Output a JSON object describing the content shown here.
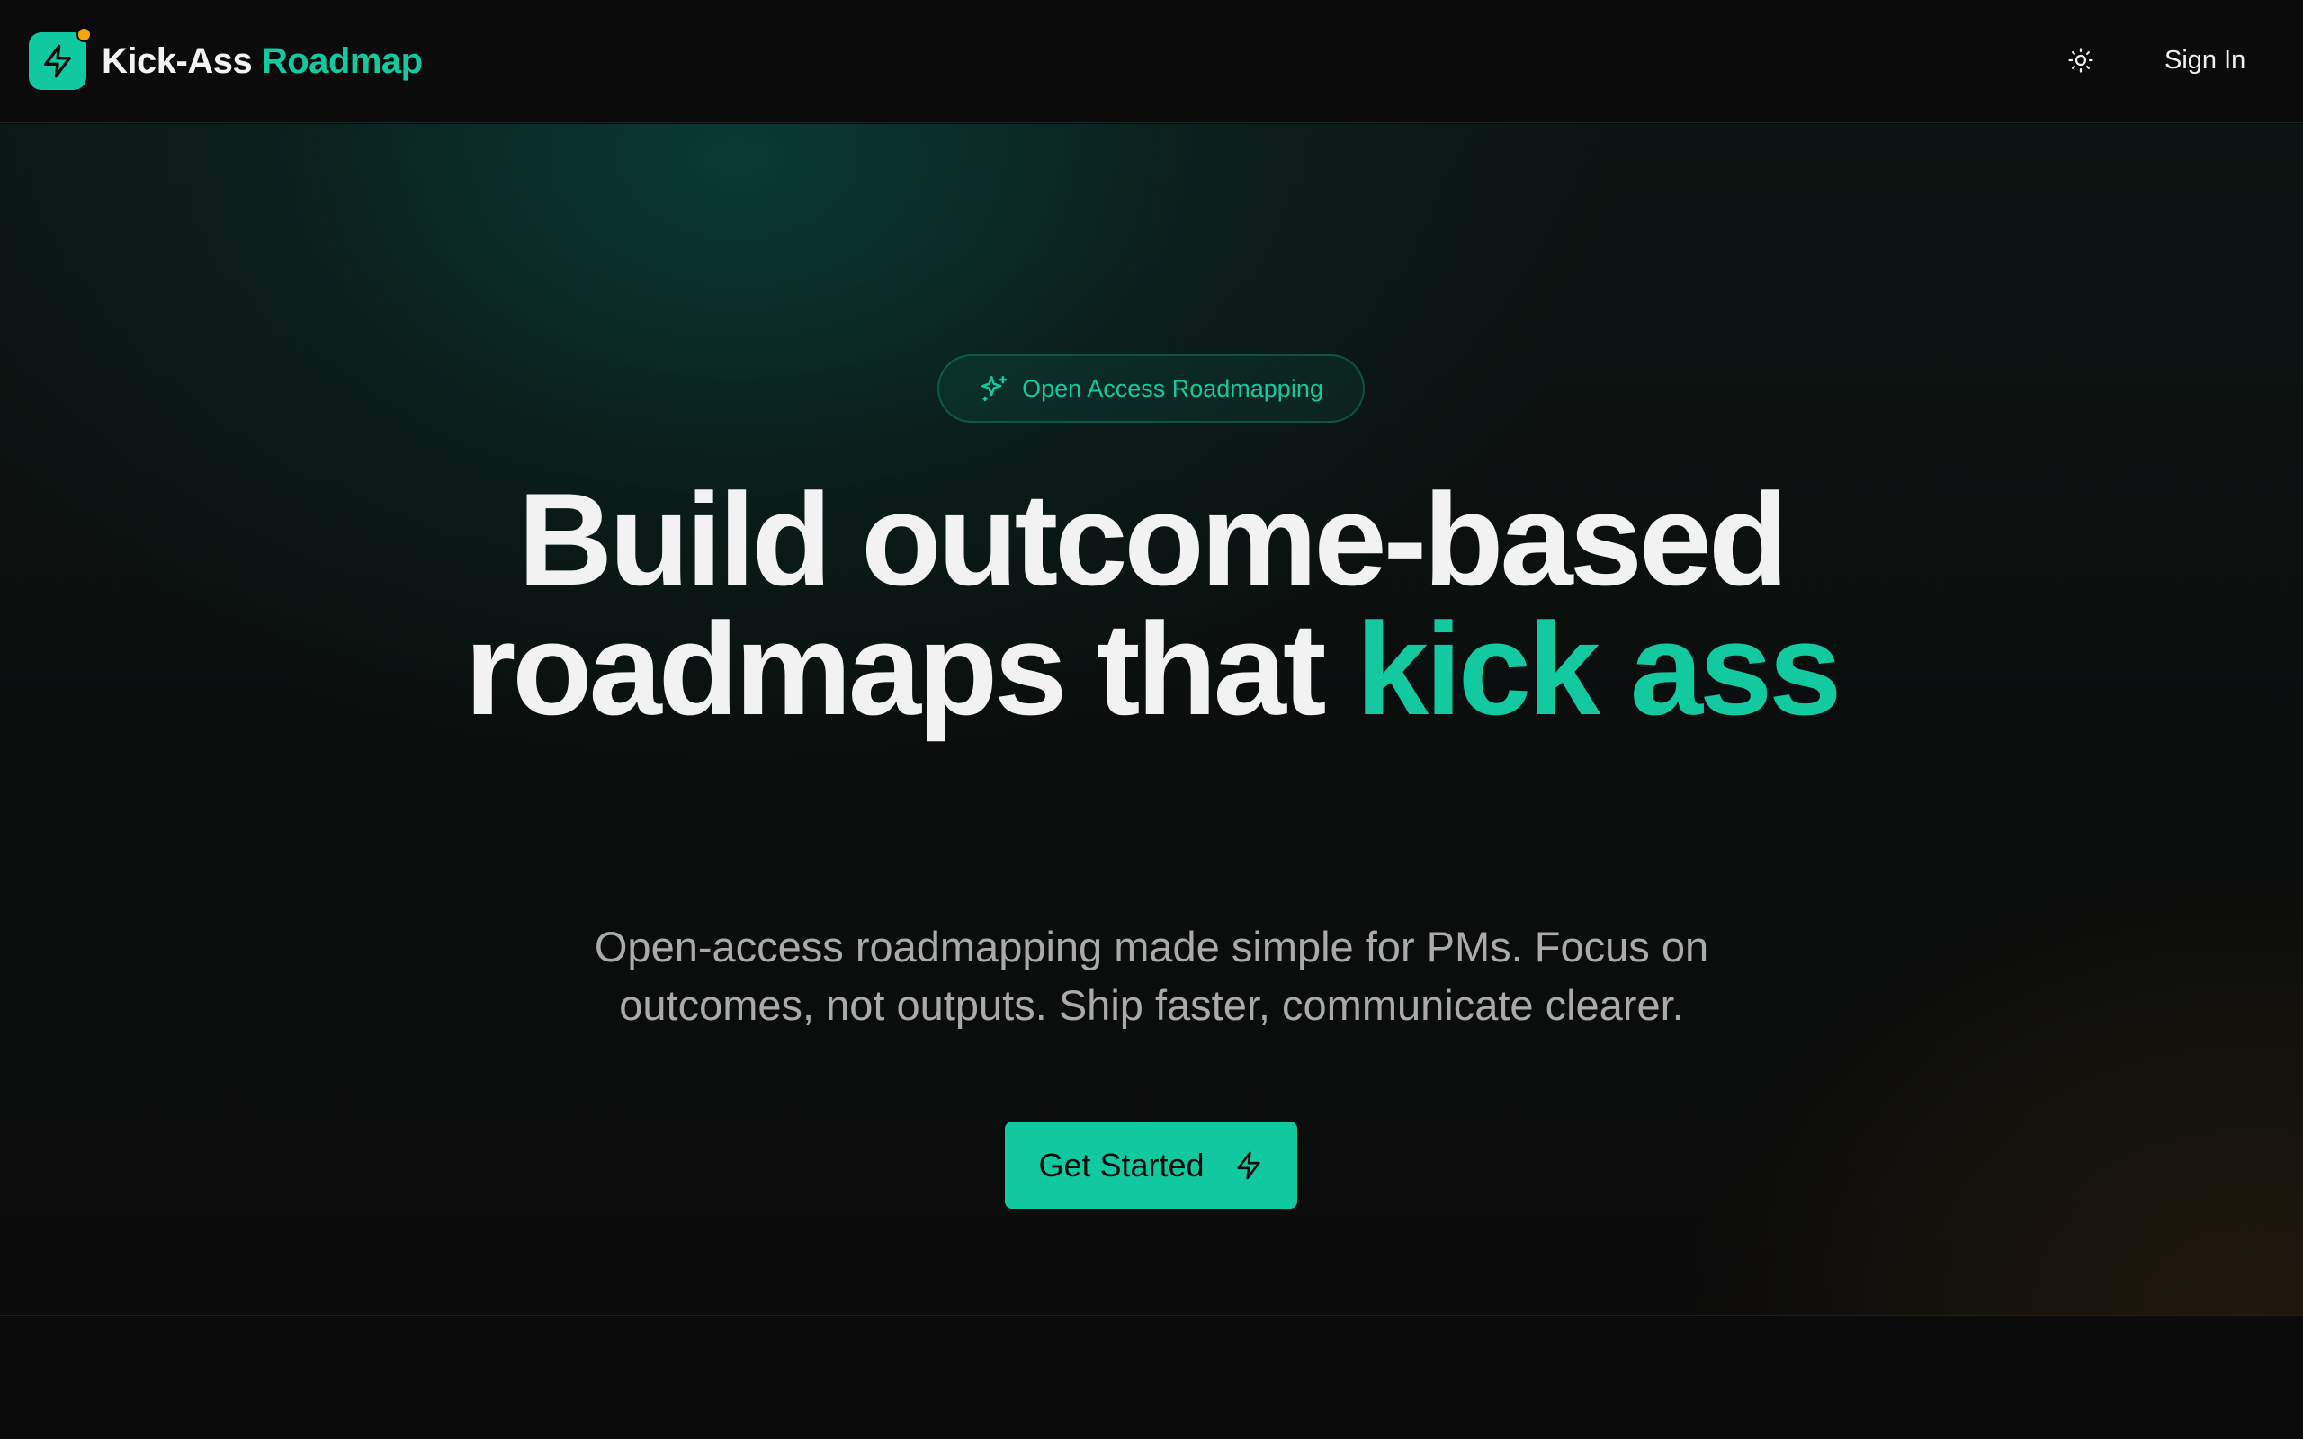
{
  "header": {
    "brand_part1": "Kick-Ass",
    "brand_part2": "Roadmap",
    "sign_in_label": "Sign In",
    "logo_icon": "lightning-bolt-icon",
    "theme_icon": "sun-icon"
  },
  "hero": {
    "badge_label": "Open Access Roadmapping",
    "badge_icon": "sparkles-icon",
    "headline_line1": "Build outcome-based",
    "headline_line2_plain": "roadmaps that ",
    "headline_line2_accent": "kick ass",
    "subtitle": "Open-access roadmapping made simple for PMs. Focus on outcomes, not outputs. Ship faster, communicate clearer.",
    "cta_label": "Get Started",
    "cta_icon": "lightning-bolt-icon"
  },
  "colors": {
    "accent": "#11c9a0",
    "notification_dot": "#f6a70c",
    "background": "#0b0b0b",
    "text_primary": "#f2f2f2",
    "text_muted": "#a9aaa9"
  }
}
